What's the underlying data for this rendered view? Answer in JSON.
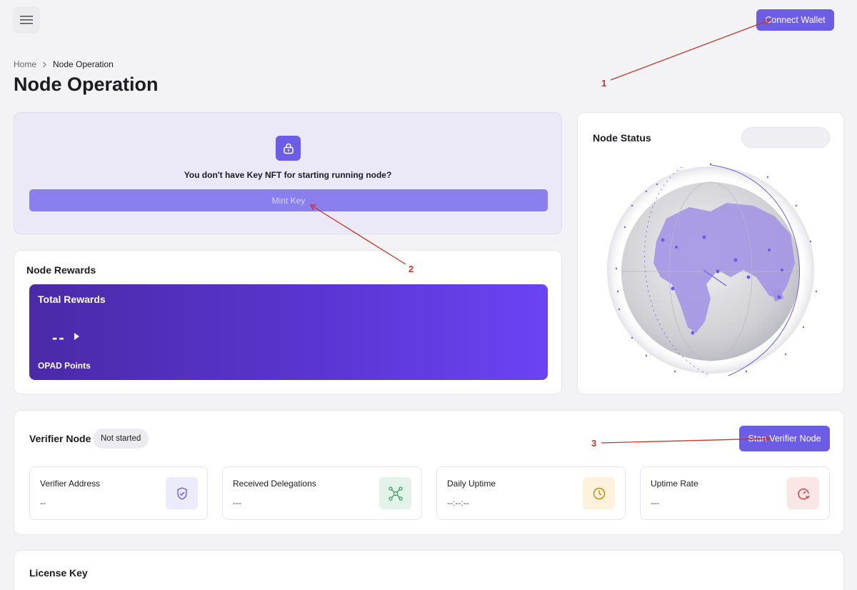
{
  "header": {
    "connect_label": "Connect Wallet"
  },
  "breadcrumb": {
    "home": "Home",
    "current": "Node Operation"
  },
  "page": {
    "title": "Node Operation"
  },
  "mint": {
    "message": "You don't have Key NFT for starting running node?",
    "button_label": "Mint Key"
  },
  "rewards": {
    "title": "Node Rewards",
    "panel_label": "Total Rewards",
    "value": "--",
    "unit": "OPAD Points"
  },
  "node_status": {
    "title": "Node Status"
  },
  "verifier": {
    "title": "Verifier Node",
    "status": "Not started",
    "start_label": "Start Verifier Node",
    "stats": [
      {
        "label": "Verifier Address",
        "value": "--",
        "icon": "shield-check-icon",
        "color": "#ecebfb"
      },
      {
        "label": "Received Delegations",
        "value": "---",
        "icon": "network-icon",
        "color": "#e3f3e9"
      },
      {
        "label": "Daily Uptime",
        "value": "--:--:--",
        "icon": "clock-icon",
        "color": "#fdf3dd"
      },
      {
        "label": "Uptime Rate",
        "value": "---",
        "icon": "gauge-icon",
        "color": "#fbe6e6"
      }
    ]
  },
  "license": {
    "title": "License Key"
  },
  "annotations": [
    "1",
    "2",
    "3"
  ],
  "colors": {
    "accent": "#6d5ce6",
    "annotation": "#c0392b"
  }
}
